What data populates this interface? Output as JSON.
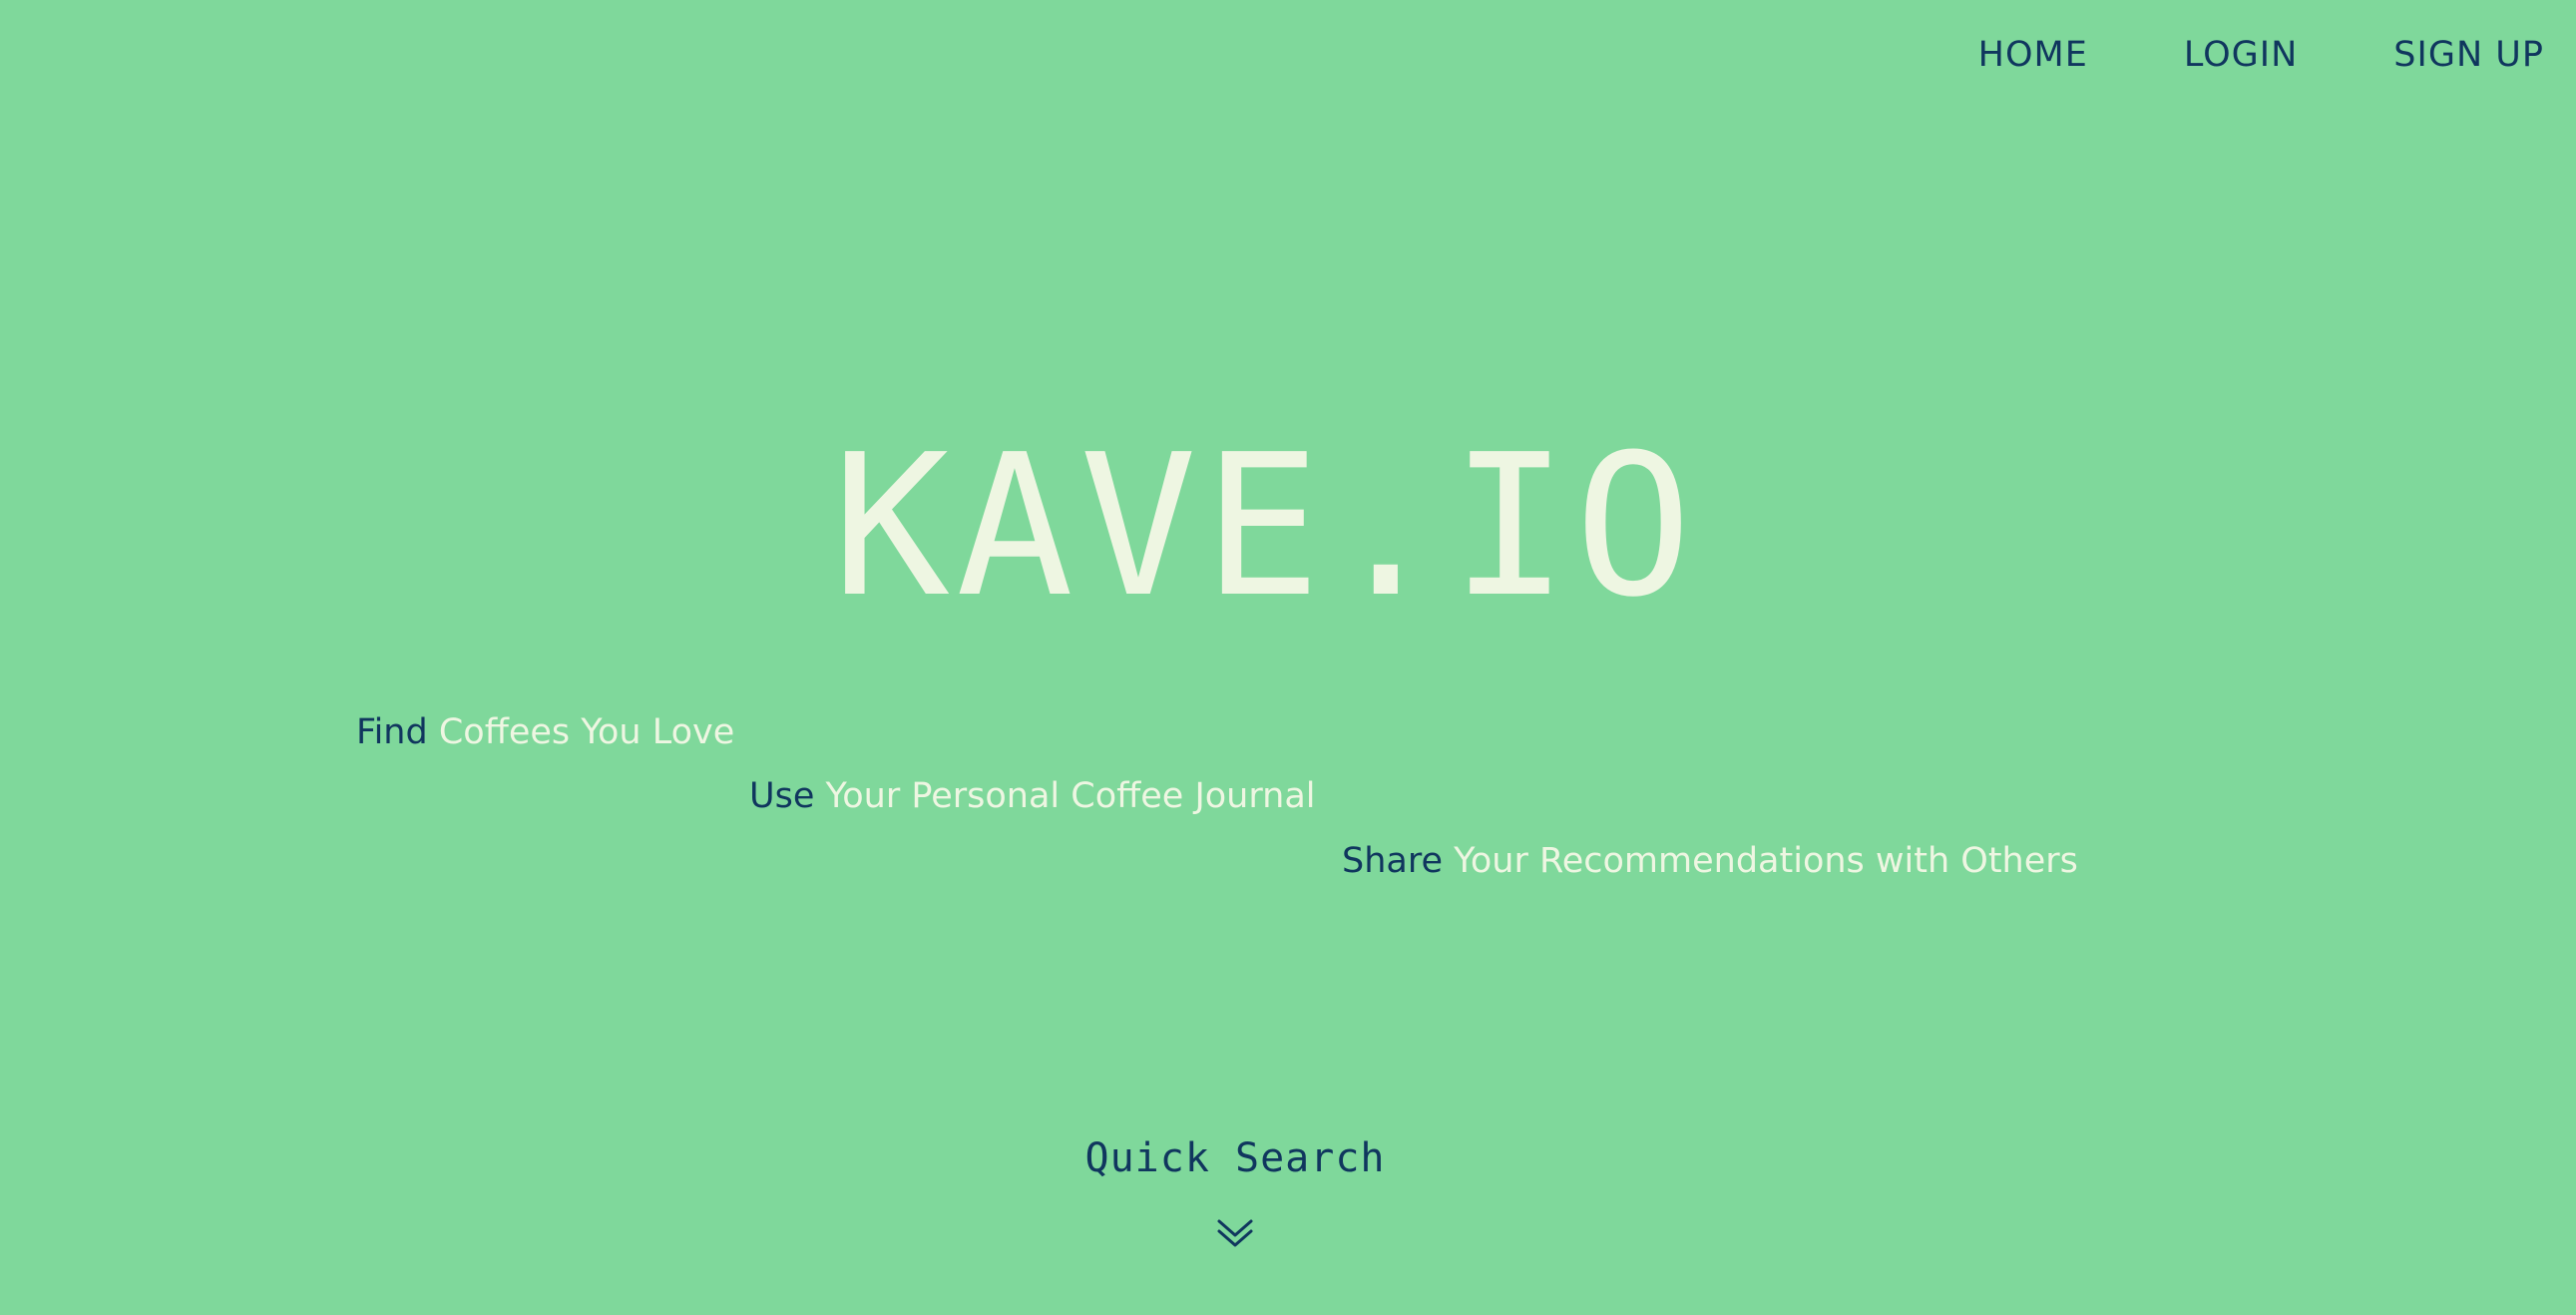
{
  "nav": {
    "home": "HOME",
    "login": "LOGIN",
    "signup": "SIGN UP"
  },
  "hero": {
    "title": "KAVE.IO"
  },
  "taglines": [
    {
      "verb": "Find",
      "rest": "Coffees You Love"
    },
    {
      "verb": "Use",
      "rest": "Your Personal Coffee Journal"
    },
    {
      "verb": "Share",
      "rest": "Your Recommendations with Others"
    }
  ],
  "quick_search": {
    "label": "Quick Search",
    "icon": "double-chevron-down-icon"
  },
  "colors": {
    "background": "#7fd89b",
    "accent_dark": "#10365e",
    "accent_light": "#eef6e2"
  }
}
